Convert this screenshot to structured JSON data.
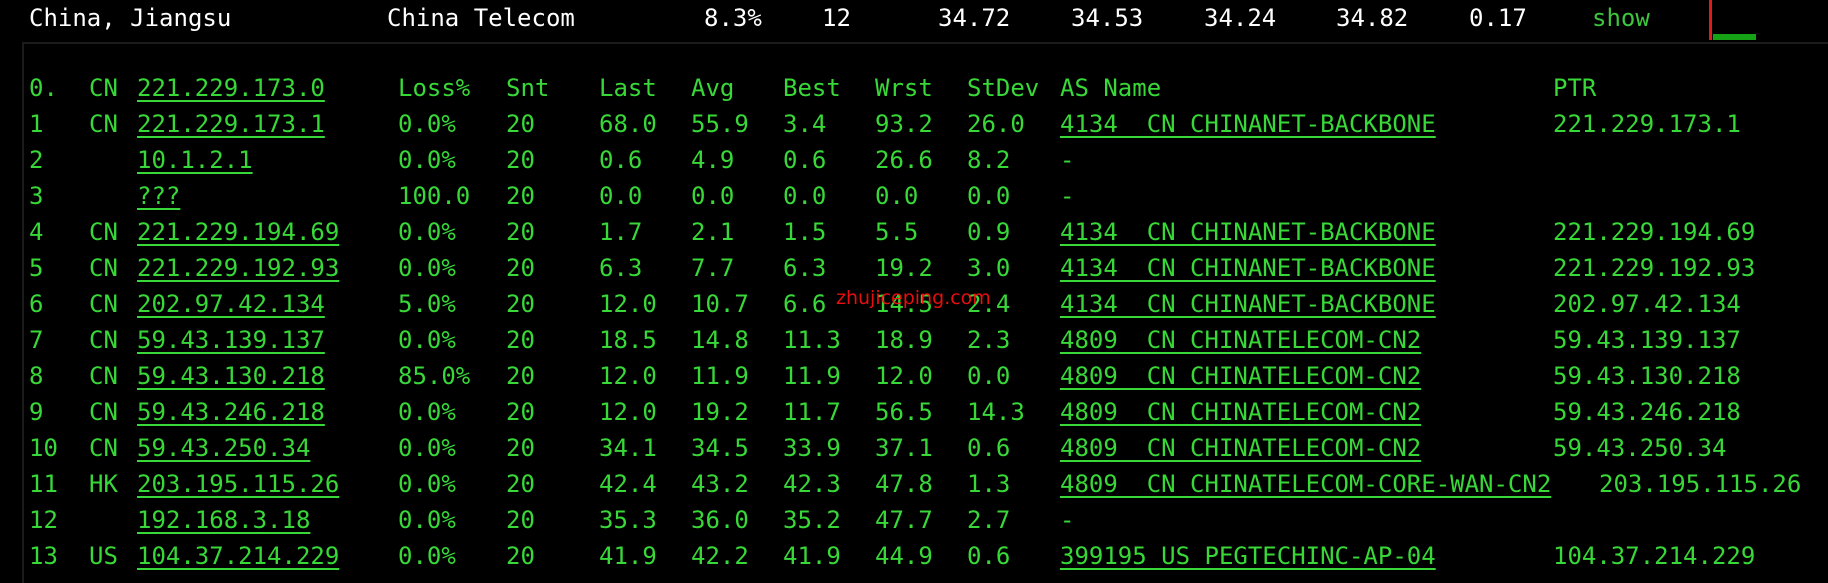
{
  "summary": {
    "location": "China, Jiangsu",
    "isp": "China Telecom",
    "loss": "8.3%",
    "sent": "12",
    "last": "34.72",
    "avg": "34.53",
    "best": "34.24",
    "worst": "34.82",
    "stdev": "0.17",
    "show_label": "show"
  },
  "header": {
    "hop": "0.",
    "cc": "CN",
    "host": "221.229.173.0",
    "loss": "Loss%",
    "snt": "Snt",
    "last": "Last",
    "avg": "Avg",
    "best": "Best",
    "wrst": "Wrst",
    "stdev": "StDev",
    "as_name": "AS Name",
    "ptr": "PTR"
  },
  "hops": [
    {
      "hop": "1",
      "cc": "CN",
      "host": "221.229.173.1",
      "loss": "0.0%",
      "snt": "20",
      "last": "68.0",
      "avg": "55.9",
      "best": "3.4",
      "wrst": "93.2",
      "stdev": "26.0",
      "as": "4134  CN CHINANET-BACKBONE",
      "ptr": "221.229.173.1"
    },
    {
      "hop": "2",
      "cc": "",
      "host": "10.1.2.1",
      "loss": "0.0%",
      "snt": "20",
      "last": "0.6",
      "avg": "4.9",
      "best": "0.6",
      "wrst": "26.6",
      "stdev": "8.2",
      "as": "-",
      "ptr": ""
    },
    {
      "hop": "3",
      "cc": "",
      "host": "???",
      "loss": "100.0",
      "snt": "20",
      "last": "0.0",
      "avg": "0.0",
      "best": "0.0",
      "wrst": "0.0",
      "stdev": "0.0",
      "as": "-",
      "ptr": ""
    },
    {
      "hop": "4",
      "cc": "CN",
      "host": "221.229.194.69",
      "loss": "0.0%",
      "snt": "20",
      "last": "1.7",
      "avg": "2.1",
      "best": "1.5",
      "wrst": "5.5",
      "stdev": "0.9",
      "as": "4134  CN CHINANET-BACKBONE",
      "ptr": "221.229.194.69"
    },
    {
      "hop": "5",
      "cc": "CN",
      "host": "221.229.192.93",
      "loss": "0.0%",
      "snt": "20",
      "last": "6.3",
      "avg": "7.7",
      "best": "6.3",
      "wrst": "19.2",
      "stdev": "3.0",
      "as": "4134  CN CHINANET-BACKBONE",
      "ptr": "221.229.192.93"
    },
    {
      "hop": "6",
      "cc": "CN",
      "host": "202.97.42.134",
      "loss": "5.0%",
      "snt": "20",
      "last": "12.0",
      "avg": "10.7",
      "best": "6.6",
      "wrst": "14.5",
      "stdev": "2.4",
      "as": "4134  CN CHINANET-BACKBONE",
      "ptr": "202.97.42.134"
    },
    {
      "hop": "7",
      "cc": "CN",
      "host": "59.43.139.137",
      "loss": "0.0%",
      "snt": "20",
      "last": "18.5",
      "avg": "14.8",
      "best": "11.3",
      "wrst": "18.9",
      "stdev": "2.3",
      "as": "4809  CN CHINATELECOM-CN2",
      "ptr": "59.43.139.137"
    },
    {
      "hop": "8",
      "cc": "CN",
      "host": "59.43.130.218",
      "loss": "85.0%",
      "snt": "20",
      "last": "12.0",
      "avg": "11.9",
      "best": "11.9",
      "wrst": "12.0",
      "stdev": "0.0",
      "as": "4809  CN CHINATELECOM-CN2",
      "ptr": "59.43.130.218"
    },
    {
      "hop": "9",
      "cc": "CN",
      "host": "59.43.246.218",
      "loss": "0.0%",
      "snt": "20",
      "last": "12.0",
      "avg": "19.2",
      "best": "11.7",
      "wrst": "56.5",
      "stdev": "14.3",
      "as": "4809  CN CHINATELECOM-CN2",
      "ptr": "59.43.246.218"
    },
    {
      "hop": "10",
      "cc": "CN",
      "host": "59.43.250.34",
      "loss": "0.0%",
      "snt": "20",
      "last": "34.1",
      "avg": "34.5",
      "best": "33.9",
      "wrst": "37.1",
      "stdev": "0.6",
      "as": "4809  CN CHINATELECOM-CN2",
      "ptr": "59.43.250.34"
    },
    {
      "hop": "11",
      "cc": "HK",
      "host": "203.195.115.26",
      "loss": "0.0%",
      "snt": "20",
      "last": "42.4",
      "avg": "43.2",
      "best": "42.3",
      "wrst": "47.8",
      "stdev": "1.3",
      "as": "4809  CN CHINATELECOM-CORE-WAN-CN2",
      "ptr": "203.195.115.26"
    },
    {
      "hop": "12",
      "cc": "",
      "host": "192.168.3.18",
      "loss": "0.0%",
      "snt": "20",
      "last": "35.3",
      "avg": "36.0",
      "best": "35.2",
      "wrst": "47.7",
      "stdev": "2.7",
      "as": "-",
      "ptr": ""
    },
    {
      "hop": "13",
      "cc": "US",
      "host": "104.37.214.229",
      "loss": "0.0%",
      "snt": "20",
      "last": "41.9",
      "avg": "42.2",
      "best": "41.9",
      "wrst": "44.9",
      "stdev": "0.6",
      "as": "399195 US PEGTECHINC-AP-04",
      "ptr": "104.37.214.229"
    }
  ],
  "watermark": "zhujiceping.com",
  "colors": {
    "terminal_green": "#38d838",
    "background": "#000000",
    "summary_text": "#ffffff",
    "spark_red": "#e01b1b",
    "spark_green": "#15a315",
    "watermark_red": "#ff1010"
  }
}
